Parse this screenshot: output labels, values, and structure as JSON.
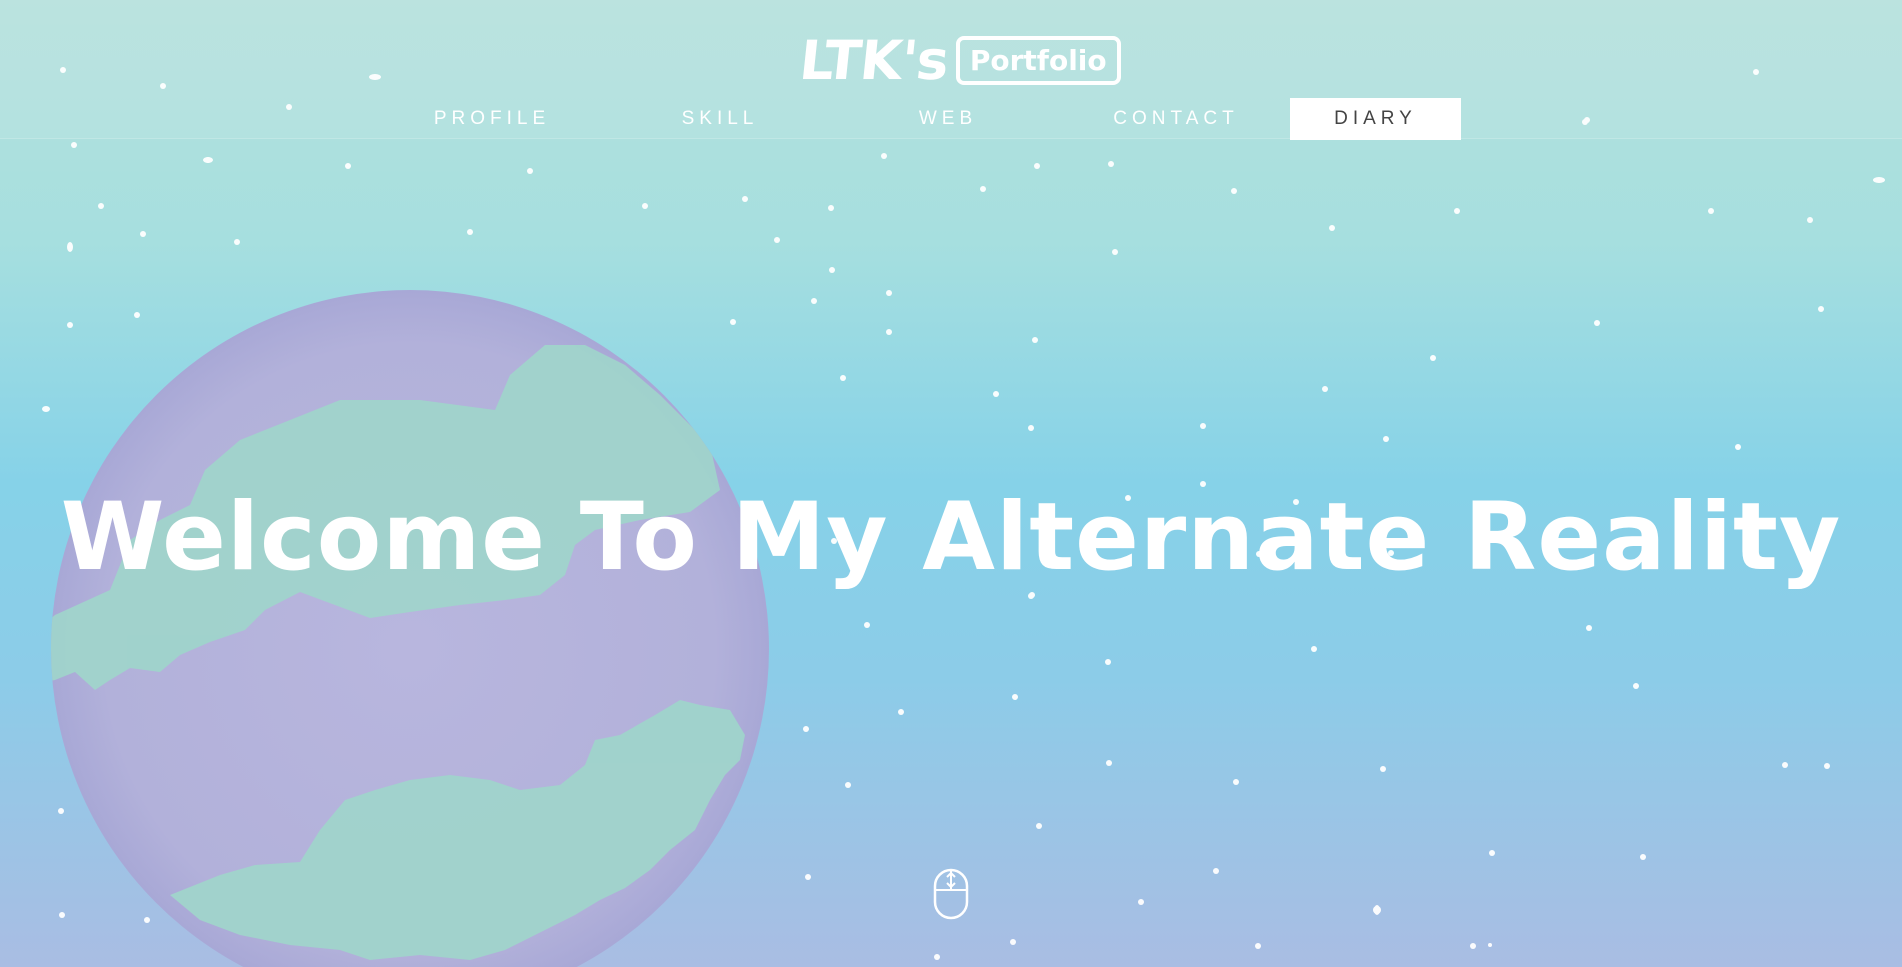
{
  "brand": {
    "name": "LTK's",
    "badge": "Portfolio"
  },
  "nav": {
    "items": [
      {
        "label": "PROFILE"
      },
      {
        "label": "SKILL"
      },
      {
        "label": "WEB"
      },
      {
        "label": "CONTACT"
      },
      {
        "label": "DIARY",
        "active": true
      }
    ]
  },
  "hero": {
    "title": "Welcome To My Alternate Reality"
  },
  "icons": {
    "scroll": "mouse-scroll-icon"
  },
  "colors": {
    "sky_top": "#b6e1dd",
    "sky_mid": "#86d2e8",
    "sky_bottom": "#a9bde3",
    "planet": "#b7b5dc",
    "continents": "#9fd5cb",
    "text": "#ffffff"
  }
}
